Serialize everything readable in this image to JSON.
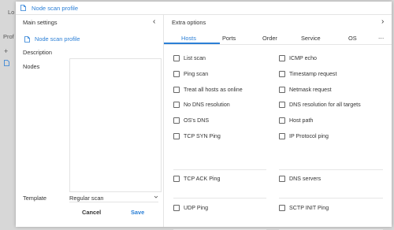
{
  "background": {
    "left_label_1": "Lo",
    "left_label_2": "Prof",
    "plus": "+"
  },
  "modal": {
    "title": "Node scan profile",
    "left": {
      "heading": "Main settings",
      "collapse_glyph": "‹",
      "profile_title": "Node scan profile",
      "description_label": "Description",
      "nodes_label": "Nodes",
      "template_label": "Template",
      "template_value": "Regular scan",
      "cancel_label": "Cancel",
      "save_label": "Save"
    },
    "right": {
      "heading": "Extra options",
      "expand_glyph": "›",
      "tabs": [
        "Hosts",
        "Ports",
        "Order",
        "Service",
        "OS"
      ],
      "more_glyph": "⋯",
      "options_col1": [
        "List scan",
        "Ping scan",
        "Treat all hosts as online",
        "No DNS resolution",
        "OS's DNS",
        "TCP SYN Ping",
        "TCP ACK Ping",
        "UDP Ping"
      ],
      "options_col2": [
        "ICMP echo",
        "Timestamp request",
        "Netmask request",
        "DNS resolution for all targets",
        "Host path",
        "IP Protocol ping",
        "DNS servers",
        "SCTP INIT Ping"
      ]
    }
  },
  "colors": {
    "accent": "#2b7fd6",
    "backdrop": "#d7d7d7",
    "border": "#e4e4e4"
  }
}
